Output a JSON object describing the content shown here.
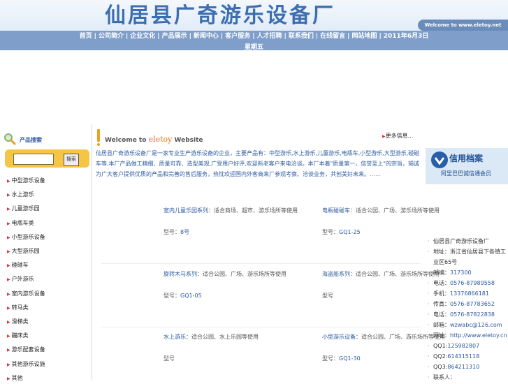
{
  "header": {
    "site_title": "仙居县广奇游乐设备厂",
    "welcome_banner": "Welcome to www.eletoy.net",
    "nav_items": [
      "首页",
      "公司简介",
      "企业文化",
      "产品展示",
      "新闻中心",
      "客户服务",
      "人才招聘",
      "联系我们",
      "在线留言",
      "网站地图"
    ],
    "date_text": "2011年6月3日",
    "weekday_text": "星期五"
  },
  "sidebar": {
    "search_title": "产品搜索",
    "search_placeholder": "",
    "search_button": "搜索",
    "categories": [
      "中型游乐设备",
      "水上游乐",
      "儿童游乐园",
      "电瓶车类",
      "小型游乐设备",
      "大型游乐园",
      "碰碰车",
      "户外游乐",
      "室内游乐设备",
      "转马类",
      "滑梯类",
      "蹦床类",
      "游乐配套设备",
      "其他游乐设施",
      "其他"
    ]
  },
  "main": {
    "welcome_prefix": "Welcome to",
    "welcome_brand": "eletoy",
    "welcome_suffix": "Website",
    "more_label": "更多信息...",
    "intro": "仙居县广奇游乐设备厂是一家专业生产游乐设备的企业，主要产品有：中型游乐,水上游乐,儿童游乐,电瓶车,小型游乐,大型游乐,碰碰车等,本厂产品做工精细、质量可靠、造型美观,广受用户好评,欢迎新老客户来电洽谈。本厂本着\"质量第一，信誉至上\"的宗旨，竭诚为广大客户提供优质的产品和完善的售后服务，热忱欢迎国内外客商来厂参观考察、洽谈业务，共创美好未来。",
    "intro_more": "……",
    "products": [
      {
        "name": "室内儿童乐园系列",
        "desc": "：适合商场、超市、游乐场所等使用",
        "code_label": "型号：",
        "code": "8号"
      },
      {
        "name": "电瓶碰碰车",
        "desc": "：适合公园、广场、游乐场所等使用",
        "code_label": "型号：",
        "code": "GQ1-25"
      },
      {
        "name": "旋转木马系列",
        "desc": "：适合公园、广场、游乐场所等使用",
        "code_label": "型号：",
        "code": "GQ1-05"
      },
      {
        "name": "海盗船系列",
        "desc": "：适合公园、广场、游乐场所等使用",
        "code_label": "型号",
        "code": ""
      },
      {
        "name": "水上游乐",
        "desc": "：适合公园、水上乐园等使用",
        "code_label": "型号",
        "code": ""
      },
      {
        "name": "小型游乐设备",
        "desc": "：适合公园、广场、游乐场所等使用",
        "code_label": "型号：",
        "code": "GQ1-30"
      }
    ]
  },
  "right": {
    "credit_title": "信用档案",
    "credit_sub": "阿里巴巴诚信通会员",
    "contacts": [
      {
        "label": "仙居县广奇游乐设备厂",
        "value": ""
      },
      {
        "label": "地址：浙江省仙居县下各镇工业区65号",
        "value": ""
      },
      {
        "label": "邮编：",
        "value": "317300"
      },
      {
        "label": "电话：",
        "value": "0576-87989558"
      },
      {
        "label": "手机：",
        "value": "13376866181"
      },
      {
        "label": "传真：",
        "value": "0576-87783652"
      },
      {
        "label": "电话：",
        "value": "0576-87822838"
      },
      {
        "label": "邮箱：",
        "value": "wzwabc@126.com"
      },
      {
        "label": "网址：",
        "value": "http://www.eletoy.cn"
      },
      {
        "label": "QQ1:",
        "value": "125982807"
      },
      {
        "label": "QQ2:",
        "value": "614315118"
      },
      {
        "label": "QQ3:",
        "value": "864211310"
      },
      {
        "label": "联系人：",
        "value": ""
      }
    ]
  },
  "colors": {
    "nav_bg": "#7f9fca",
    "title_blue": "#3d6fb0",
    "link_blue": "#2d5aa0",
    "search_yellow": "#f5c545",
    "accent_orange": "#e0760d"
  }
}
